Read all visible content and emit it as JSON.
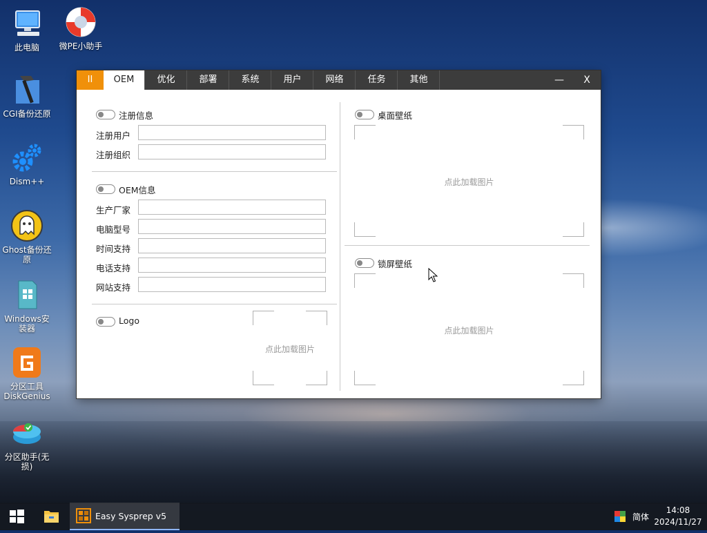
{
  "desktop": {
    "icons": [
      {
        "label": "此电脑"
      },
      {
        "label": "微PE小助手"
      },
      {
        "label": "CGI备份还原"
      },
      {
        "label": "Dism++"
      },
      {
        "label": "Ghost备份还原"
      },
      {
        "label": "Windows安装器"
      },
      {
        "label": "分区工具\nDiskGenius"
      },
      {
        "label": "分区助手(无损)"
      }
    ]
  },
  "window": {
    "tabs": [
      {
        "label": "II"
      },
      {
        "label": "OEM"
      },
      {
        "label": "优化"
      },
      {
        "label": "部署"
      },
      {
        "label": "系统"
      },
      {
        "label": "用户"
      },
      {
        "label": "网络"
      },
      {
        "label": "任务"
      },
      {
        "label": "其他"
      }
    ],
    "active_tab": "OEM",
    "minimize_label": "—",
    "close_label": "X",
    "registration": {
      "title": "注册信息",
      "fields": [
        {
          "label": "注册用户",
          "value": ""
        },
        {
          "label": "注册组织",
          "value": ""
        }
      ]
    },
    "oem": {
      "title": "OEM信息",
      "fields": [
        {
          "label": "生产厂家",
          "value": ""
        },
        {
          "label": "电脑型号",
          "value": ""
        },
        {
          "label": "时间支持",
          "value": ""
        },
        {
          "label": "电话支持",
          "value": ""
        },
        {
          "label": "网站支持",
          "value": ""
        }
      ]
    },
    "logo": {
      "title": "Logo",
      "hint": "点此加载图片"
    },
    "desktop_wallpaper": {
      "title": "桌面壁纸",
      "hint": "点此加载图片"
    },
    "lock_wallpaper": {
      "title": "锁屏壁纸",
      "hint": "点此加载图片"
    }
  },
  "taskbar": {
    "app_label": "Easy Sysprep v5",
    "ime": "简体",
    "time": "14:08",
    "date": "2024/11/27"
  },
  "colors": {
    "pause_tab": "#f0900a",
    "titlebar": "#3c3c3c"
  }
}
